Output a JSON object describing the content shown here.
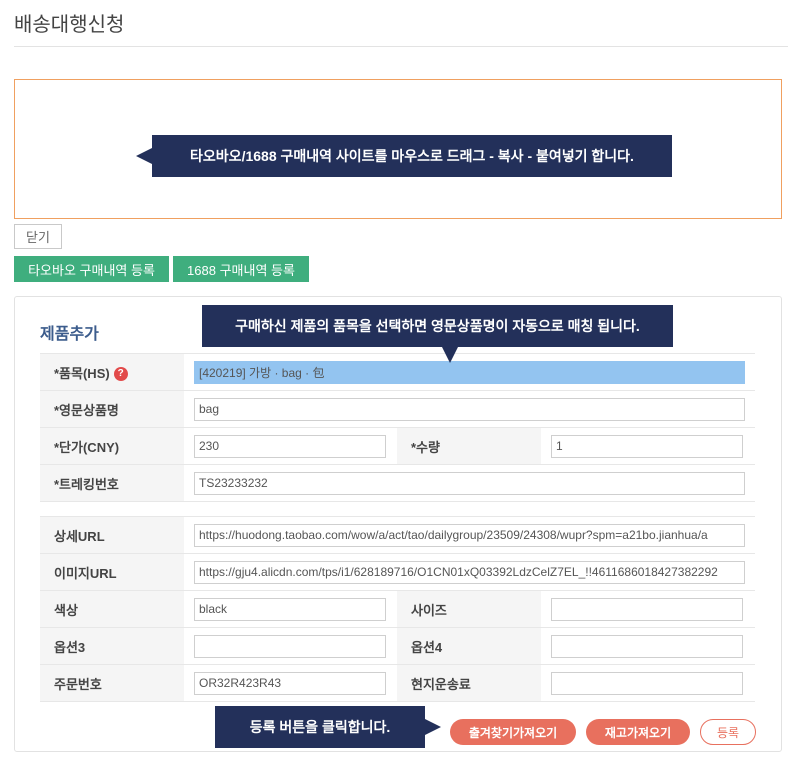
{
  "page": {
    "title": "배송대행신청"
  },
  "callouts": {
    "paste_hint": "타오바오/1688 구매내역 사이트를 마우스로 드래그 - 복사 - 붙여넣기 합니다.",
    "product_hint": "구매하신 제품의 품목을 선택하면 영문상품명이 자동으로 매칭 됩니다.",
    "register_hint": "등록 버튼을 클릭합니다."
  },
  "buttons": {
    "close": "닫기",
    "taobao_register": "타오바오 구매내역 등록",
    "register_1688": "1688 구매내역 등록",
    "shipping_fetch": "출겨찾기가져오기",
    "stock_fetch": "재고가져오기",
    "register": "등록"
  },
  "form": {
    "section_title": "제품추가",
    "labels": {
      "item": "*품목(HS)",
      "english_name": "*영문상품명",
      "unit_price": "*단가(CNY)",
      "quantity": "*수량",
      "tracking": "*트레킹번호",
      "detail_url": "상세URL",
      "image_url": "이미지URL",
      "color": "색상",
      "size": "사이즈",
      "option3": "옵션3",
      "option4": "옵션4",
      "order_number": "주문번호",
      "local_shipping": "현지운송료"
    },
    "values": {
      "item": "[420219] 가방 · bag · 包",
      "english_name": "bag",
      "unit_price": "230",
      "quantity": "1",
      "tracking": "TS23233232",
      "detail_url": "https://huodong.taobao.com/wow/a/act/tao/dailygroup/23509/24308/wupr?spm=a21bo.jianhua/a",
      "image_url": "https://gju4.alicdn.com/tps/i1/628189716/O1CN01xQ03392LdzCelZ7EL_!!4611686018427382292",
      "color": "black",
      "size": "",
      "option3": "",
      "option4": "",
      "order_number": "OR32R423R43",
      "local_shipping": ""
    }
  },
  "colors": {
    "callout_bg": "#23305a",
    "green_button": "#3fae7e",
    "action_button": "#e8705e",
    "paste_border": "#f0a060",
    "highlight_field": "#93c4f0"
  }
}
